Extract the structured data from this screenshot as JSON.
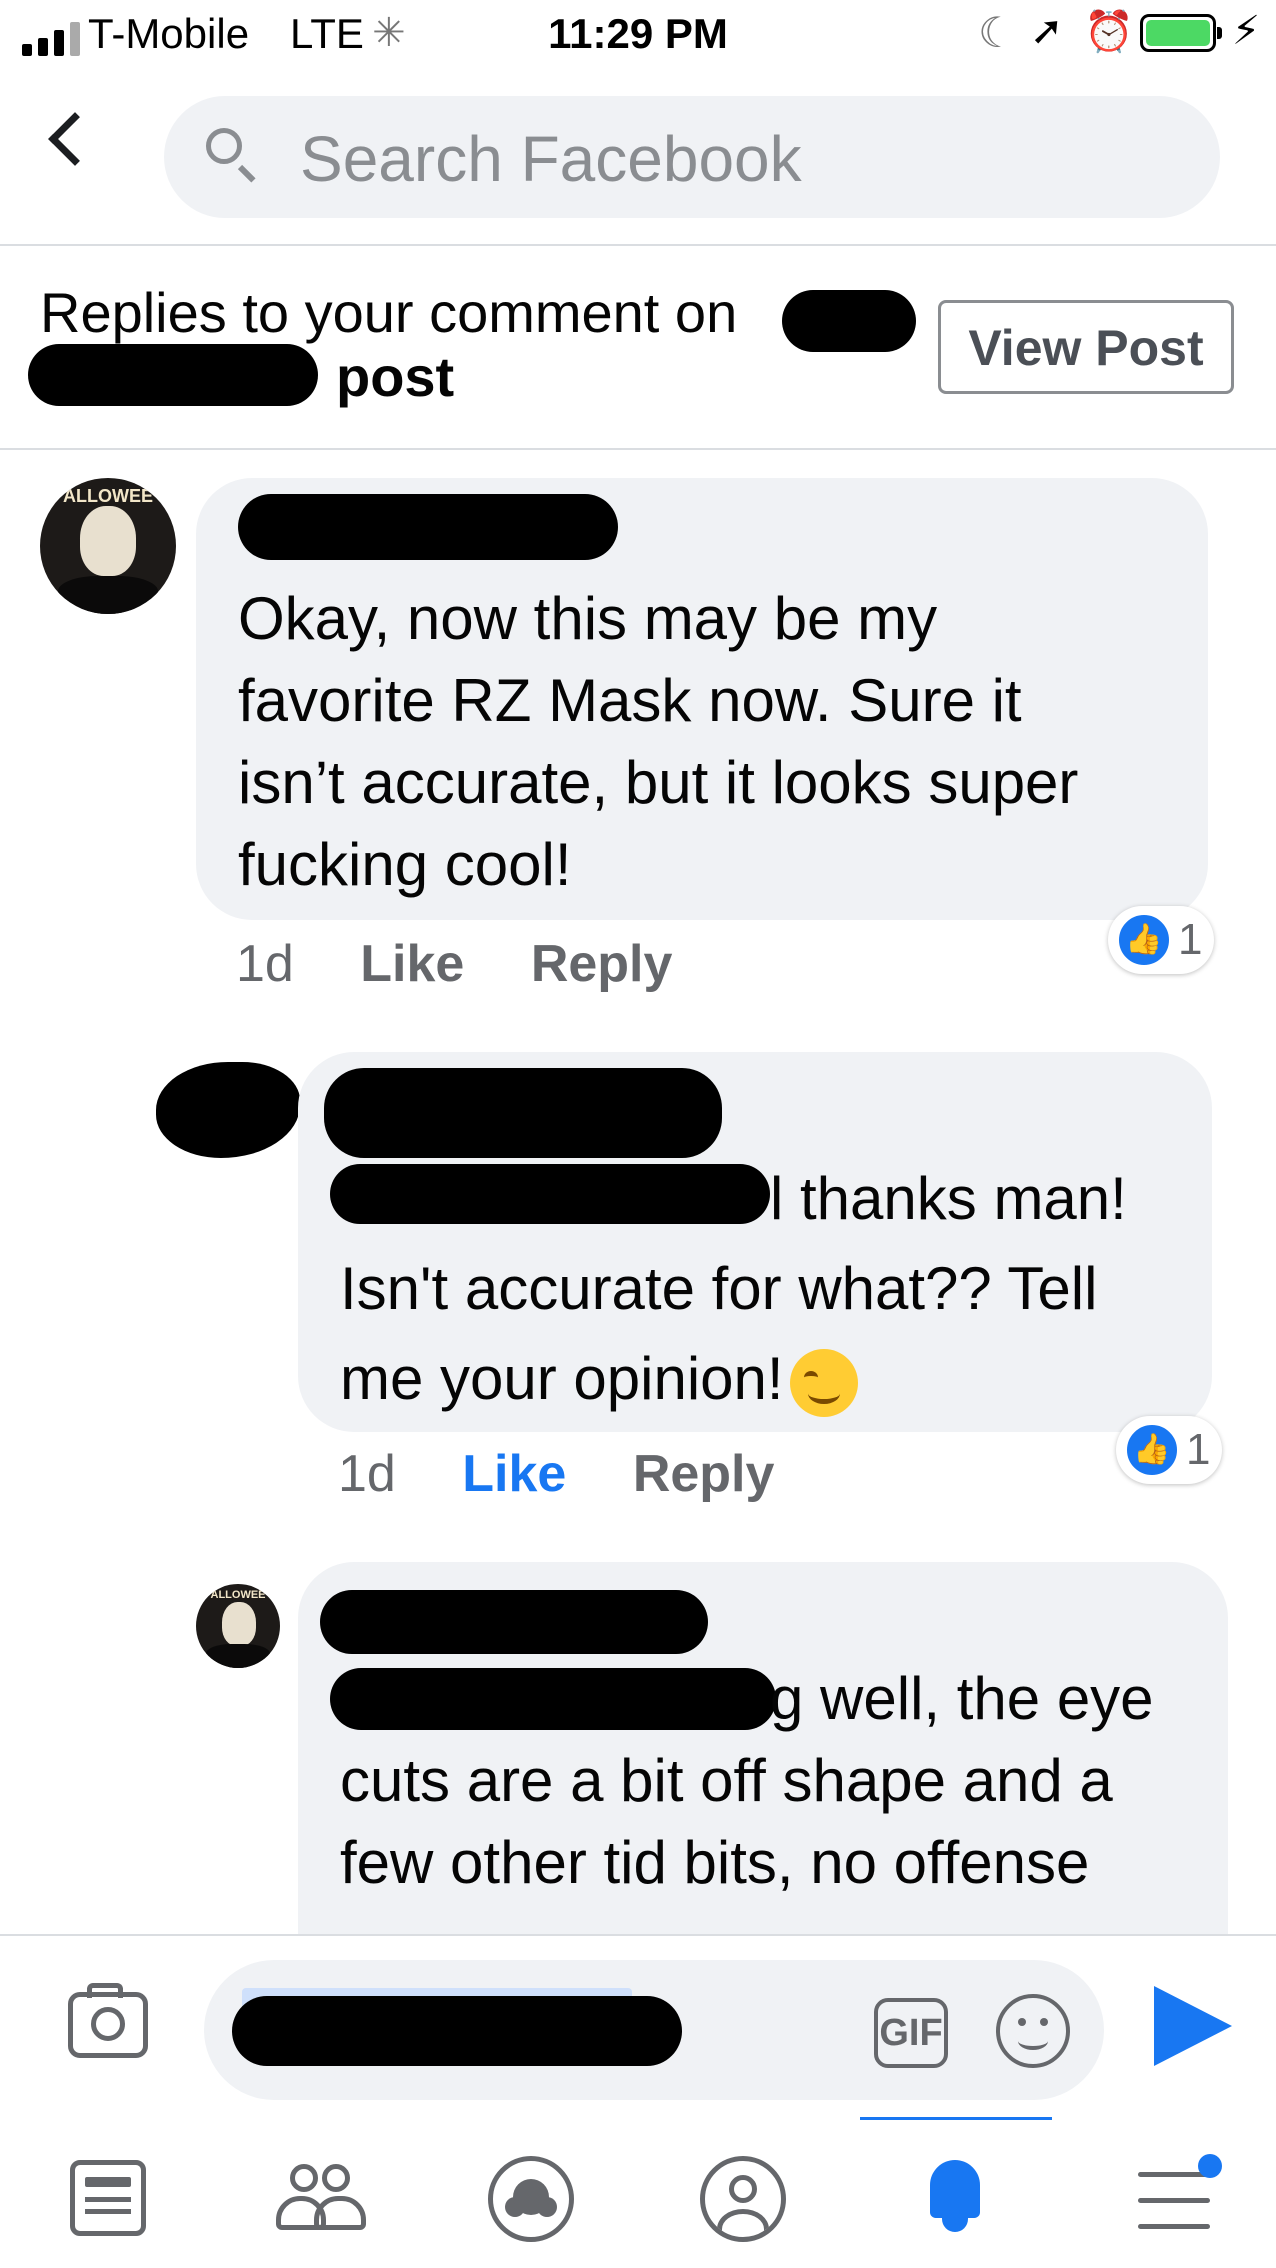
{
  "status_bar": {
    "carrier": "T-Mobile",
    "network": "LTE",
    "time": "11:29 PM"
  },
  "search": {
    "placeholder": "Search Facebook"
  },
  "context": {
    "prefix": "Replies to your comment on",
    "suffix": "post",
    "view_post_label": "View Post"
  },
  "comments": [
    {
      "text": "Okay, now this may be my favorite RZ Mask now. Sure it isn’t accurate, but it looks super fucking cool!",
      "lines": [
        "Okay, now this may be my",
        "favorite RZ Mask now. Sure it",
        "isn’t accurate, but it looks super",
        "fucking cool!"
      ],
      "time": "1d",
      "like_label": "Like",
      "reply_label": "Reply",
      "reaction_count": "1",
      "avatar_text": "ALLOWEE"
    },
    {
      "lines": [
        "l thanks man!",
        "Isn't accurate for what?? Tell",
        "me your opinion!"
      ],
      "time": "1d",
      "like_label": "Like",
      "reply_label": "Reply",
      "reaction_count": "1",
      "liked": true
    },
    {
      "lines": [
        "g well, the eye",
        "cuts are a bit off shape and a",
        "few other tid bits, no offense"
      ],
      "avatar_text": "ALLOWEE"
    }
  ],
  "composer": {
    "gif_label": "GIF"
  },
  "tabs": [
    {
      "icon": "news-feed-icon"
    },
    {
      "icon": "friends-icon"
    },
    {
      "icon": "groups-icon"
    },
    {
      "icon": "profile-icon"
    },
    {
      "icon": "notifications-bell-icon",
      "active": true
    },
    {
      "icon": "menu-icon",
      "badge": true
    }
  ],
  "colors": {
    "accent": "#1877f2",
    "bubble": "#f0f2f5",
    "secondary_text": "#65676b",
    "battery": "#4cd964"
  }
}
